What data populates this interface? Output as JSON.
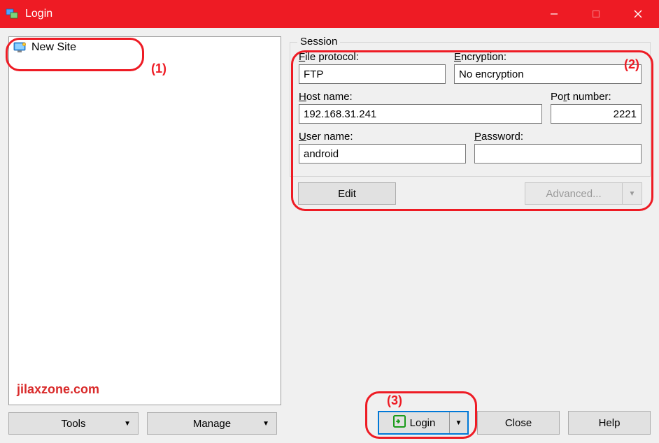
{
  "window": {
    "title": "Login"
  },
  "tree": {
    "site_label": "New Site"
  },
  "session": {
    "legend": "Session",
    "file_protocol_label": "File protocol:",
    "file_protocol_value": "FTP",
    "encryption_label": "Encryption:",
    "encryption_value": "No encryption",
    "host_name_label": "Host name:",
    "host_name_value": "192.168.31.241",
    "port_number_label": "Port number:",
    "port_number_value": "2221",
    "user_name_label": "User name:",
    "user_name_value": "android",
    "password_label": "Password:",
    "password_value": ""
  },
  "buttons": {
    "edit": "Edit",
    "advanced": "Advanced...",
    "tools": "Tools",
    "manage": "Manage",
    "login": "Login",
    "close": "Close",
    "help": "Help"
  },
  "annotations": {
    "one": "(1)",
    "two": "(2)",
    "three": "(3)"
  },
  "watermark": "jilaxzone.com"
}
